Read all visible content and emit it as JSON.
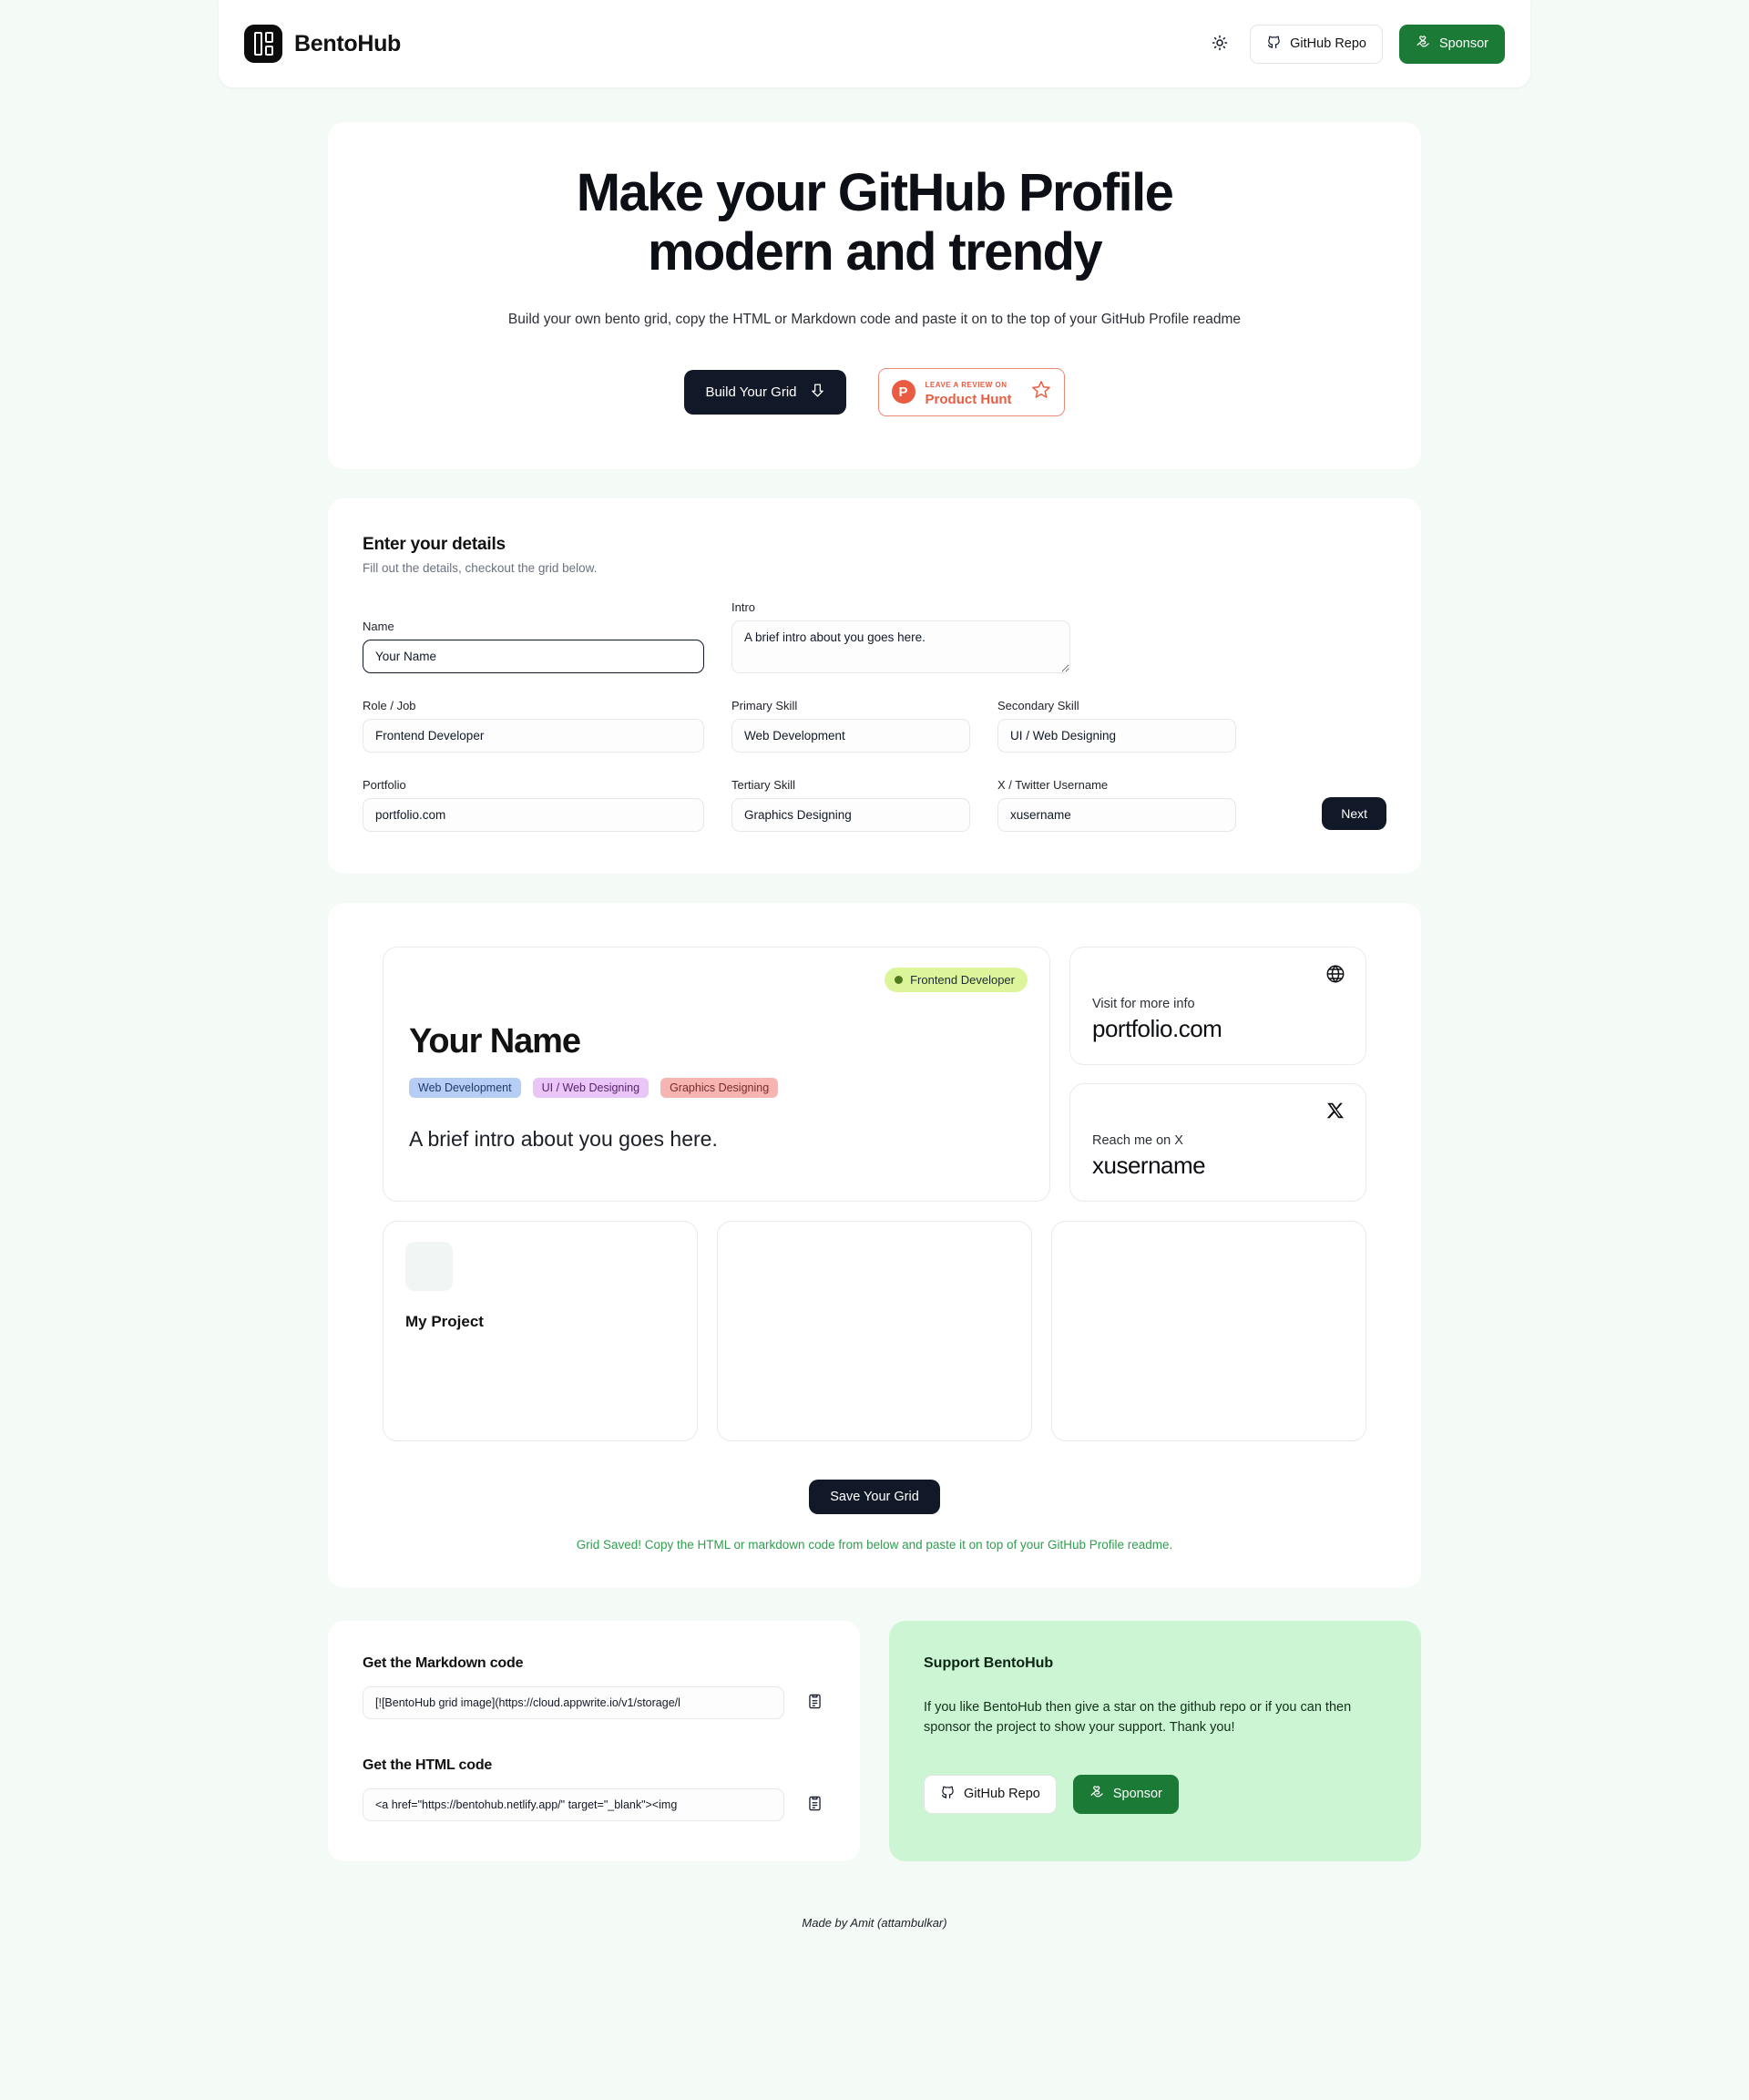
{
  "header": {
    "brand": "BentoHub",
    "theme_toggle_icon": "sun-icon",
    "github_label": "GitHub Repo",
    "sponsor_label": "Sponsor"
  },
  "hero": {
    "title": "Make your GitHub Profile modern and trendy",
    "subtitle": "Build your own bento grid, copy the HTML or Markdown code and paste it on to the top of your GitHub Profile readme",
    "build_label": "Build Your Grid",
    "product_hunt": {
      "logo_letter": "P",
      "top_line": "LEAVE A REVIEW ON",
      "main_line": "Product Hunt"
    }
  },
  "form": {
    "title": "Enter your details",
    "subtitle": "Fill out the details, checkout the grid below.",
    "fields": [
      {
        "label": "Name",
        "value": "Your Name",
        "placeholder": "Your Name"
      },
      {
        "label": "Intro",
        "value": "A brief intro about you goes here.",
        "placeholder": "A brief intro about you goes here."
      },
      {
        "label": "Role / Job",
        "value": "Frontend Developer",
        "placeholder": "Frontend Developer"
      },
      {
        "label": "Primary Skill",
        "value": "Web Development",
        "placeholder": "Web Development"
      },
      {
        "label": "Secondary Skill",
        "value": "UI / Web Designing",
        "placeholder": "UI / Web Designing"
      },
      {
        "label": "Portfolio",
        "value": "portfolio.com",
        "placeholder": "portfolio.com"
      },
      {
        "label": "Tertiary Skill",
        "value": "Graphics Designing",
        "placeholder": "Graphics Designing"
      },
      {
        "label": "X / Twitter Username",
        "value": "xusername",
        "placeholder": "xusername"
      }
    ],
    "next_label": "Next"
  },
  "preview": {
    "role_badge": "Frontend Developer",
    "name": "Your Name",
    "skills": [
      "Web Development",
      "UI / Web Designing",
      "Graphics Designing"
    ],
    "intro": "A brief intro about you goes here.",
    "portfolio_card": {
      "icon": "globe-icon",
      "label": "Visit for more info",
      "value": "portfolio.com"
    },
    "x_card": {
      "icon": "x-logo-icon",
      "label": "Reach me on X",
      "value": "xusername"
    },
    "projects": [
      {
        "title": "My Project"
      },
      {
        "title": ""
      },
      {
        "title": ""
      }
    ],
    "save_label": "Save Your Grid",
    "saved_message": "Grid Saved! Copy the HTML or markdown code from below and paste it on top of your GitHub Profile readme."
  },
  "code": {
    "markdown_title": "Get the Markdown code",
    "markdown_value": "[![BentoHub grid image](https://cloud.appwrite.io/v1/storage/l",
    "html_title": "Get the HTML code",
    "html_value": "<a href=\"https://bentohub.netlify.app/\" target=\"_blank\"><img",
    "copy_icon": "clipboard-icon"
  },
  "support": {
    "title": "Support BentoHub",
    "text": "If you like BentoHub then give a star on the github repo or if you can then sponsor the project to show your support. Thank you!",
    "github_label": "GitHub Repo",
    "sponsor_label": "Sponsor"
  },
  "footer": {
    "text": "Made by Amit (attambulkar)"
  },
  "colors": {
    "page_bg": "#f4fbf6",
    "accent_green": "#1c7a37",
    "success_text": "#2f9e4f",
    "support_bg": "#ccf5d4",
    "dark": "#111827",
    "product_hunt_red": "#ea5c42"
  }
}
